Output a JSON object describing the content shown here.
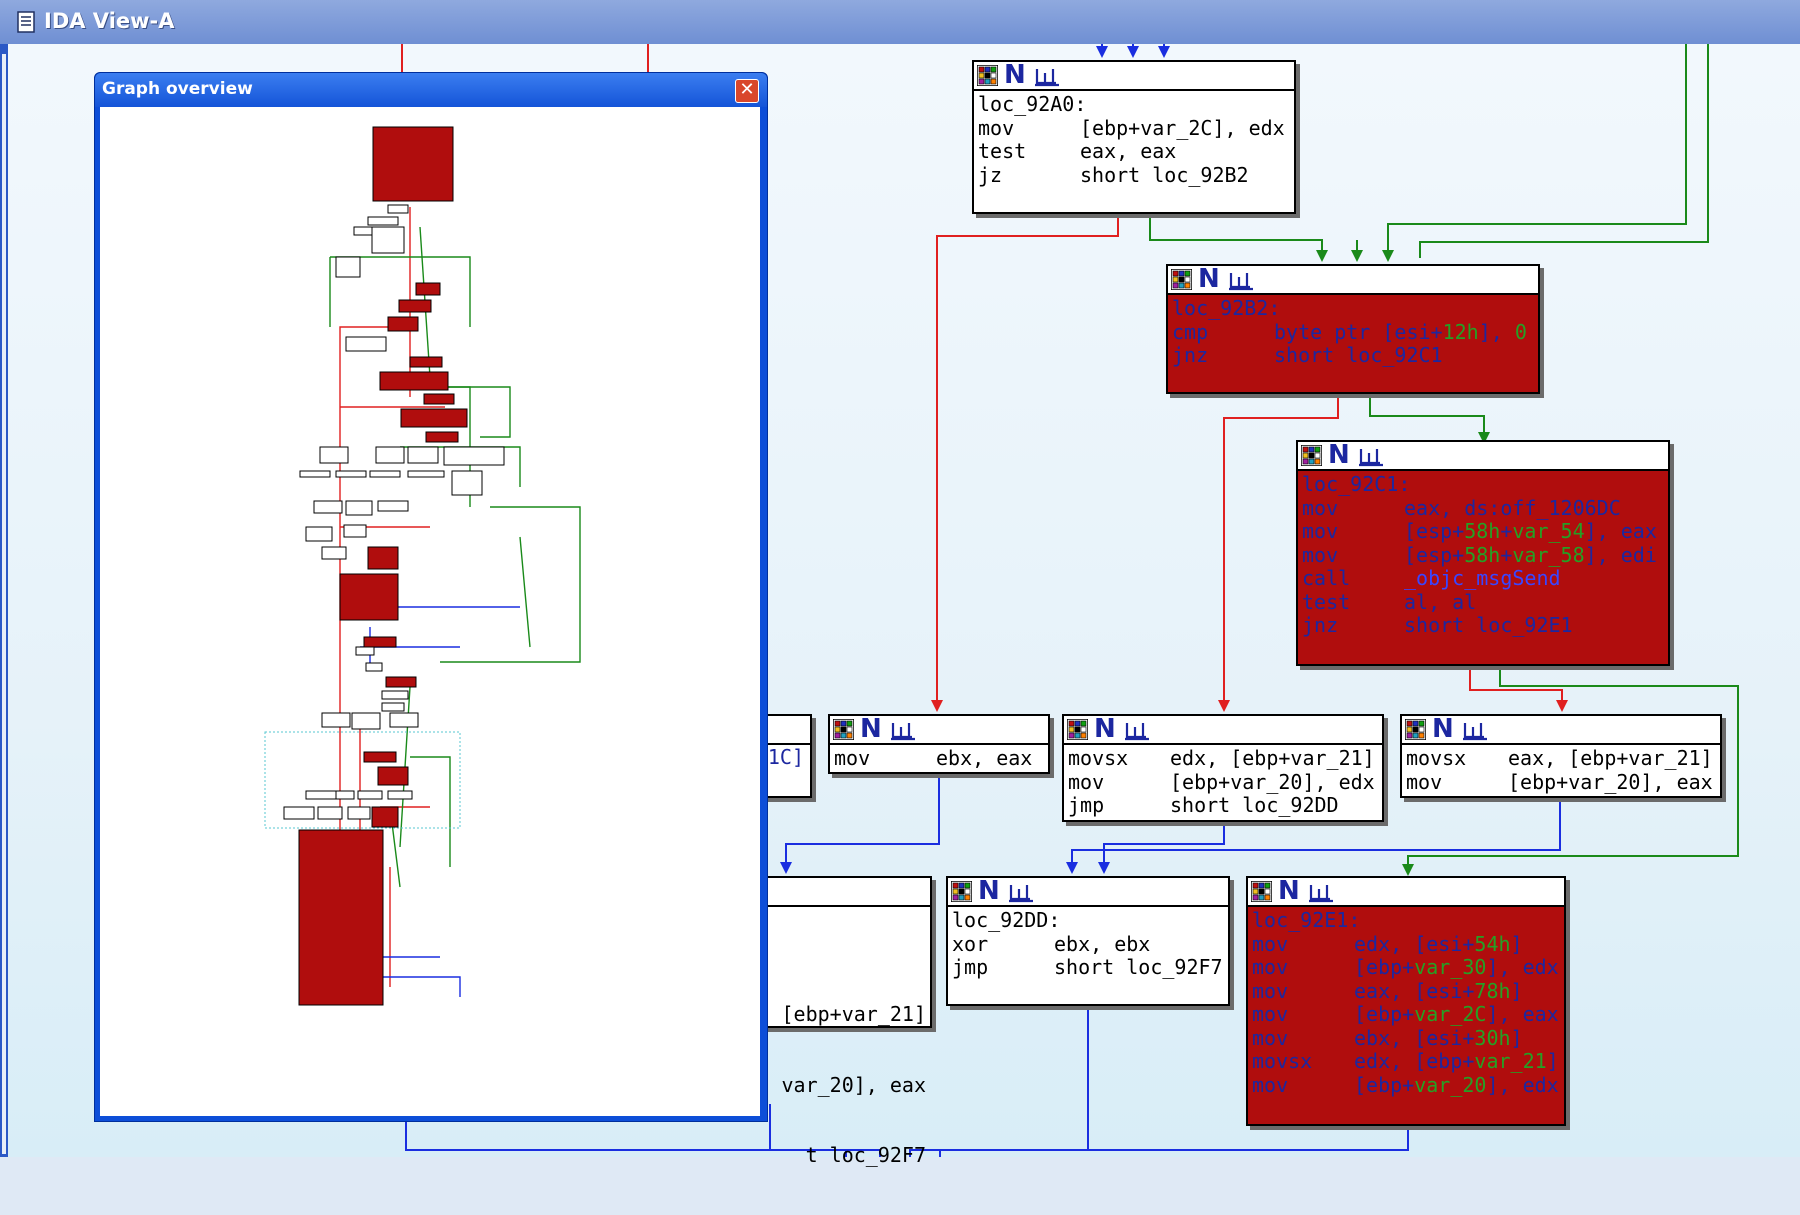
{
  "window": {
    "title": "IDA View-A"
  },
  "overview": {
    "title": "Graph overview",
    "close_glyph": "✕"
  },
  "header_icons": {
    "n_label": "N"
  },
  "nodes": {
    "n92A0": {
      "lines": [
        {
          "label": "loc_92A0:"
        },
        {
          "mn": "mov",
          "ops": [
            [
              "[ebp+",
              ""
            ],
            [
              "var_2C",
              "var"
            ],
            [
              "], edx",
              ""
            ]
          ]
        },
        {
          "mn": "test",
          "ops": [
            [
              "eax, eax",
              ""
            ]
          ]
        },
        {
          "mn": "jz",
          "ops": [
            [
              "short loc_92B2",
              ""
            ]
          ]
        }
      ]
    },
    "n92B2": {
      "lines": [
        {
          "label": "loc_92B2:"
        },
        {
          "mn": "cmp",
          "ops": [
            [
              "byte ptr [esi+",
              ""
            ],
            [
              "12h",
              "var"
            ],
            [
              "], ",
              ""
            ],
            [
              "0",
              "var"
            ]
          ]
        },
        {
          "mn": "jnz",
          "ops": [
            [
              "short loc_92C1",
              ""
            ]
          ]
        }
      ]
    },
    "n92C1": {
      "lines": [
        {
          "label": "loc_92C1:"
        },
        {
          "mn": "mov",
          "ops": [
            [
              "eax, ds:off_1206DC",
              ""
            ]
          ]
        },
        {
          "mn": "mov",
          "ops": [
            [
              "[esp+",
              ""
            ],
            [
              "58h",
              "var"
            ],
            [
              "+",
              ""
            ],
            [
              "var_54",
              "var"
            ],
            [
              "], eax",
              ""
            ]
          ]
        },
        {
          "mn": "mov",
          "ops": [
            [
              "[esp+",
              ""
            ],
            [
              "58h",
              "var"
            ],
            [
              "+",
              ""
            ],
            [
              "var_58",
              "var"
            ],
            [
              "], edi",
              ""
            ]
          ]
        },
        {
          "mn": "call",
          "ops": [
            [
              "_objc_msgSend",
              "fn"
            ]
          ]
        },
        {
          "mn": "test",
          "ops": [
            [
              "al, al",
              ""
            ]
          ]
        },
        {
          "mn": "jnz",
          "ops": [
            [
              "short loc_92E1",
              ""
            ]
          ]
        }
      ]
    },
    "nMovEbx": {
      "lines": [
        {
          "mn": "mov",
          "ops": [
            [
              "ebx, eax",
              ""
            ]
          ]
        }
      ]
    },
    "nMovsxA": {
      "lines": [
        {
          "mn": "movsx",
          "ops": [
            [
              "edx, [ebp+",
              ""
            ],
            [
              "var_21",
              "var"
            ],
            [
              "]",
              ""
            ]
          ]
        },
        {
          "mn": "mov",
          "ops": [
            [
              "[ebp+",
              ""
            ],
            [
              "var_20",
              "var"
            ],
            [
              "], edx",
              ""
            ]
          ]
        },
        {
          "mn": "jmp",
          "ops": [
            [
              "short loc_92DD",
              ""
            ]
          ]
        }
      ]
    },
    "nMovsxB": {
      "lines": [
        {
          "mn": "movsx",
          "ops": [
            [
              "eax, [ebp+",
              ""
            ],
            [
              "var_21",
              "var"
            ],
            [
              "]",
              ""
            ]
          ]
        },
        {
          "mn": "mov",
          "ops": [
            [
              "[ebp+",
              ""
            ],
            [
              "var_20",
              "var"
            ],
            [
              "], eax",
              ""
            ]
          ]
        }
      ]
    },
    "n92DD": {
      "lines": [
        {
          "label": "loc_92DD:"
        },
        {
          "mn": "xor",
          "ops": [
            [
              "ebx, ebx",
              ""
            ]
          ]
        },
        {
          "mn": "jmp",
          "ops": [
            [
              "short loc_92F7",
              ""
            ]
          ]
        }
      ]
    },
    "n92E1": {
      "lines": [
        {
          "label": "loc_92E1:"
        },
        {
          "mn": "mov",
          "ops": [
            [
              "edx, [esi+",
              ""
            ],
            [
              "54h",
              "var"
            ],
            [
              "]",
              ""
            ]
          ]
        },
        {
          "mn": "mov",
          "ops": [
            [
              "[ebp+",
              ""
            ],
            [
              "var_30",
              "var"
            ],
            [
              "], edx",
              ""
            ]
          ]
        },
        {
          "mn": "mov",
          "ops": [
            [
              "eax, [esi+",
              ""
            ],
            [
              "78h",
              "var"
            ],
            [
              "]",
              ""
            ]
          ]
        },
        {
          "mn": "mov",
          "ops": [
            [
              "[ebp+",
              ""
            ],
            [
              "var_2C",
              "var"
            ],
            [
              "], eax",
              ""
            ]
          ]
        },
        {
          "mn": "mov",
          "ops": [
            [
              "ebx, [esi+",
              ""
            ],
            [
              "30h",
              "var"
            ],
            [
              "]",
              ""
            ]
          ]
        },
        {
          "mn": "movsx",
          "ops": [
            [
              "edx, [ebp+",
              ""
            ],
            [
              "var_21",
              "var"
            ],
            [
              "]",
              ""
            ]
          ]
        },
        {
          "mn": "mov",
          "ops": [
            [
              "[ebp+",
              ""
            ],
            [
              "var_20",
              "var"
            ],
            [
              "], edx",
              ""
            ]
          ]
        }
      ]
    },
    "partialA": {
      "text": "1C]"
    },
    "partialB": {
      "lines": [
        "[ebp+var_21]",
        "var_20], eax",
        "t loc_92F7"
      ]
    }
  },
  "colors": {
    "edge_true": "#1a8a1a",
    "edge_false": "#e02020",
    "edge_uncond": "#1a2ee0",
    "node_red": "#b00d0d",
    "mnemonic": "#1c27a0",
    "variable": "#1a8a1a"
  }
}
